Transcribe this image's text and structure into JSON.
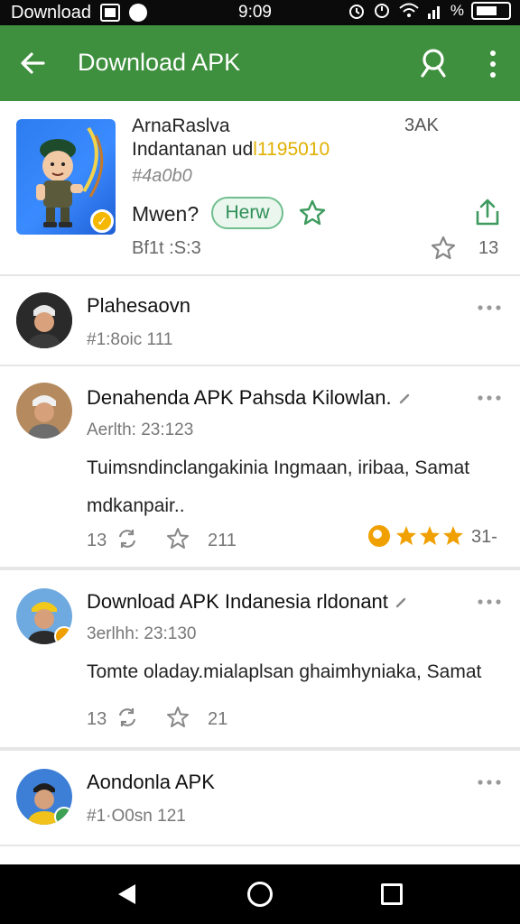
{
  "status_bar": {
    "left_text": "Download",
    "time": "9:09",
    "percent": "%"
  },
  "app_bar": {
    "title": "Download APK",
    "back_icon": "arrow-back-icon",
    "search_icon": "search-icon",
    "more_icon": "more-vert-icon",
    "color": "#3e8f3e"
  },
  "app_card": {
    "name": "ArnaRaslva",
    "developer_prefix": "Indantanan ud",
    "developer_highlight": "l1195010",
    "tag": "#4a0b0",
    "size": "3AK",
    "question": "Mwen?",
    "new_button": "Herw",
    "meta": "Bf1t :S:3",
    "count": "13"
  },
  "posts": [
    {
      "name": "Plahesaovn",
      "sub": "#1:8oic 111",
      "sub_gold": true
    },
    {
      "name": "Denahenda APK Pahsda Kilowlan.",
      "sub": "Aerlth: 23:123",
      "body": "Tuimsndinclangakinia Ingmaan, iribaa, Samat mdkanpair..",
      "replies": "13",
      "stars_count": "211",
      "rating_count": "31-"
    },
    {
      "name": "Download APK Indanesia rldonant",
      "sub": "3erlhh: 23:130",
      "body": "Tomte oladay.mialaplsan ghaimhyniaka, Samat",
      "replies": "13",
      "stars_count": "21"
    },
    {
      "name": "Aondonla APK",
      "sub": "#1·O0sn 121",
      "sub_gold": true
    }
  ],
  "colors": {
    "accent_green": "#3e8f3e",
    "gold": "#e0a400",
    "new_button_border": "#6fbf8e"
  }
}
